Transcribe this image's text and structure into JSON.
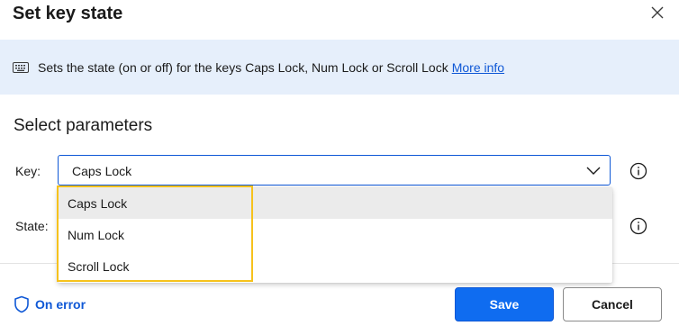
{
  "dialog": {
    "title": "Set key state",
    "info": {
      "text": "Sets the state (on or off) for the keys Caps Lock, Num Lock or Scroll Lock",
      "link": "More info"
    },
    "section_title": "Select parameters",
    "key": {
      "label": "Key:",
      "value": "Caps Lock",
      "options": [
        "Caps Lock",
        "Num Lock",
        "Scroll Lock"
      ]
    },
    "state": {
      "label": "State:"
    },
    "footer": {
      "on_error": "On error",
      "save": "Save",
      "cancel": "Cancel"
    }
  },
  "colors": {
    "accent": "#0f6cf0",
    "info_bg": "#e6effb",
    "highlight": "#f6c21c"
  }
}
